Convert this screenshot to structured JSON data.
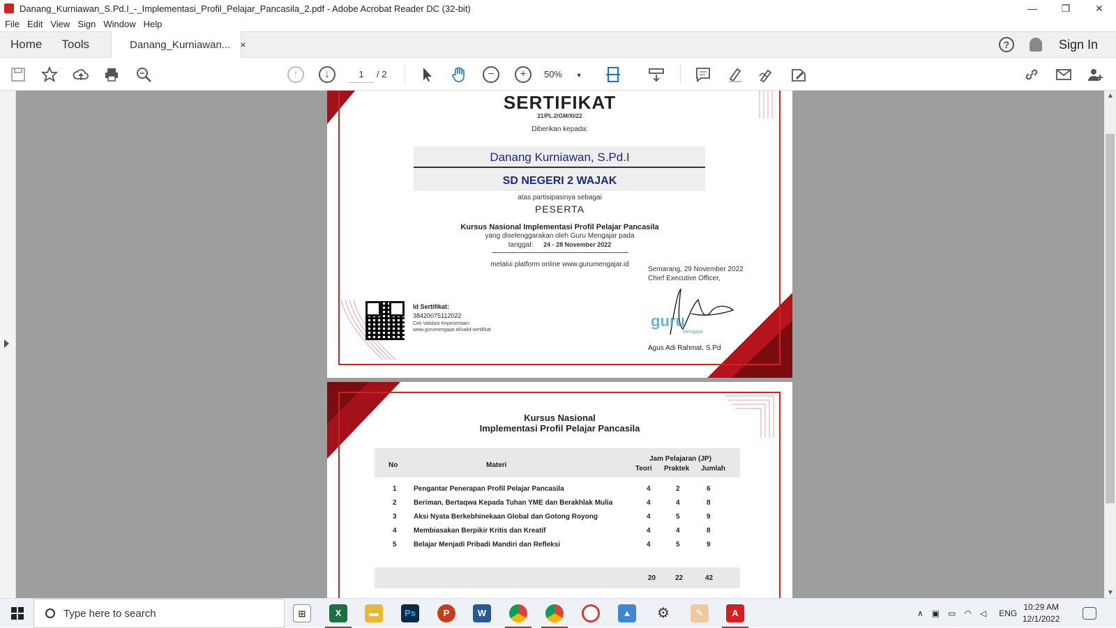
{
  "window": {
    "title": "Danang_Kurniawan_S.Pd.I_-_Implementasi_Profil_Pelajar_Pancasila_2.pdf - Adobe Acrobat Reader DC (32-bit)",
    "minimize": "—",
    "maximize": "❐",
    "close": "✕"
  },
  "menu": [
    "File",
    "Edit",
    "View",
    "Sign",
    "Window",
    "Help"
  ],
  "tabs": {
    "home": "Home",
    "tools": "Tools",
    "document": "Danang_Kurniawan...",
    "close": "×",
    "help": "?",
    "signin": "Sign In"
  },
  "toolbar": {
    "page_current": "1",
    "page_total": "/ 2",
    "zoom": "50%"
  },
  "page1": {
    "title": "SERTIFIKAT",
    "number": "21/PL.2/GM/XI/22",
    "given_to": "Diberikan kepada:",
    "name": "Danang Kurniawan, S.Pd.I",
    "school": "SD NEGERI 2 WAJAK",
    "participation": "atas partisipasinya sebagai",
    "role": "PESERTA",
    "course": "Kursus Nasional Implementasi Profil Pelajar Pancasila",
    "organizer": "yang diselenggarakan oleh Guru Mengajar pada",
    "date_label": "tanggal:",
    "date_value": "24 - 28 November 2022",
    "platform": "melalui platform online www.gurumengajar.id",
    "place_date": "Semarang, 29 November 2022",
    "ceo_title": "Chief Executive Officer,",
    "logo_text": "guru",
    "logo_sub": "Mengajar",
    "signer": "Agus Adi Rahmat, S.Pd",
    "id_label": "Id Sertifikat:",
    "id_value": "38420075112022",
    "validation_label": "Cek Validasi Kepesertaan:",
    "validation_url": "www.gurumengajar.id/valid-sertifikat"
  },
  "page2": {
    "title_line1": "Kursus Nasional",
    "title_line2": "Implementasi Profil Pelajar Pancasila",
    "headers": {
      "no": "No",
      "materi": "Materi",
      "jp": "Jam Pelajaran (JP)",
      "teori": "Teori",
      "praktek": "Praktek",
      "jumlah": "Jumlah"
    },
    "rows": [
      {
        "no": "1",
        "materi": "Pengantar Penerapan Profil Pelajar Pancasila",
        "teori": "4",
        "praktek": "2",
        "jumlah": "6"
      },
      {
        "no": "2",
        "materi": "Beriman, Bertaqwa Kepada Tuhan YME dan Berakhlak Mulia",
        "teori": "4",
        "praktek": "4",
        "jumlah": "8"
      },
      {
        "no": "3",
        "materi": "Aksi Nyata Berkebhinekaan Global dan Gotong Royong",
        "teori": "4",
        "praktek": "5",
        "jumlah": "9"
      },
      {
        "no": "4",
        "materi": "Membiasakan Berpikir Kritis dan Kreatif",
        "teori": "4",
        "praktek": "4",
        "jumlah": "8"
      },
      {
        "no": "5",
        "materi": "Belajar Menjadi Pribadi Mandiri dan Refleksi",
        "teori": "4",
        "praktek": "5",
        "jumlah": "9"
      }
    ],
    "totals": {
      "teori": "20",
      "praktek": "22",
      "jumlah": "42"
    }
  },
  "taskbar": {
    "search_placeholder": "Type here to search",
    "language": "ENG",
    "time": "10:29 AM",
    "date": "12/1/2022"
  },
  "colors": {
    "accent_red": "#d4201f",
    "name_blue": "#1e2a78"
  }
}
